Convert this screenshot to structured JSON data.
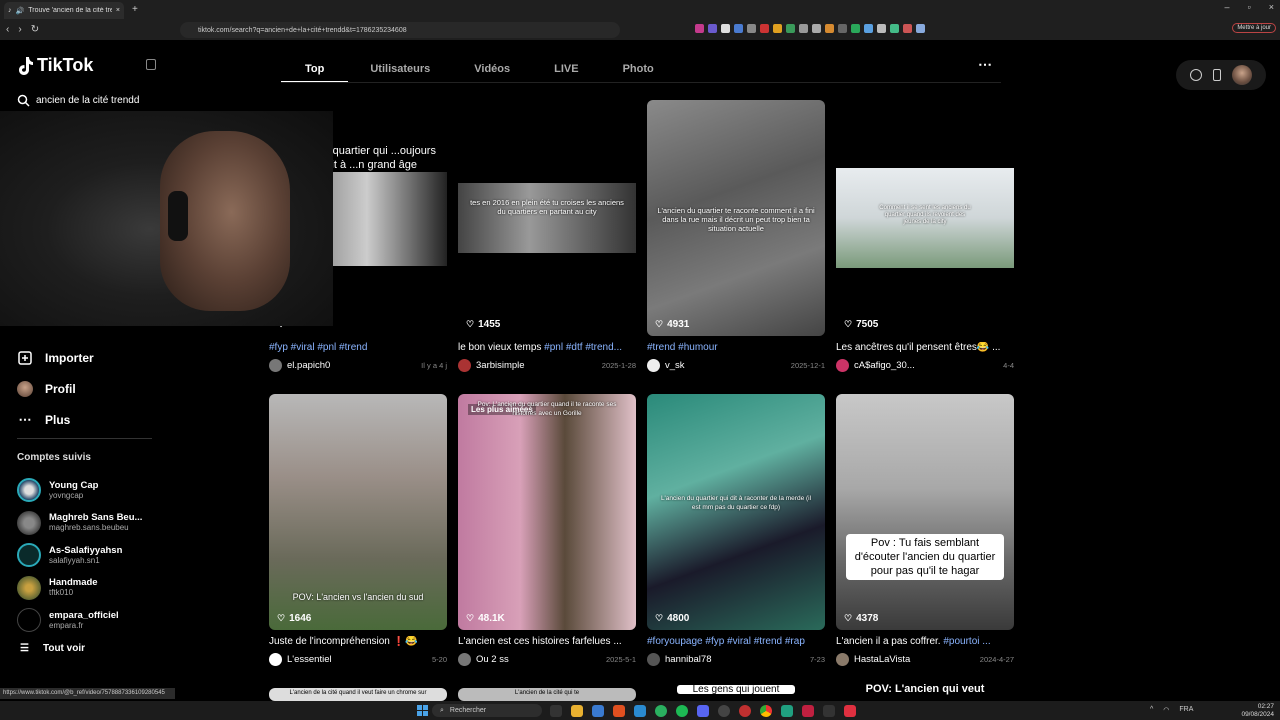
{
  "browser": {
    "tab_title": "Trouve 'ancien de la cité tren...",
    "url": "tiktok.com/search?q=ancien+de+la+cité+trendd&t=1786235234608",
    "mettre_label": "Mettre à jour",
    "status_url": "https://www.tiktok.com/@b_ref/video/7578887336109280545"
  },
  "sidebar": {
    "brand": "TikTok",
    "search_value": "ancien de la cité trendd",
    "menu": [
      {
        "label": "Importer",
        "icon": "upload-icon"
      },
      {
        "label": "Profil",
        "icon": "profile-avatar"
      },
      {
        "label": "Plus",
        "icon": "more-icon"
      }
    ],
    "following_title": "Comptes suivis",
    "following": [
      {
        "name": "Young Cap",
        "handle": "yovngcap"
      },
      {
        "name": "Maghreb Sans Beu...",
        "handle": "maghreb.sans.beubeu"
      },
      {
        "name": "As-Salafiyyahsn",
        "handle": "salafiyyah.sn1"
      },
      {
        "name": "Handmade",
        "handle": "tftk010"
      },
      {
        "name": "empara_officiel",
        "handle": "empara.fr"
      }
    ],
    "see_all": "Tout voir"
  },
  "tabs": [
    "Top",
    "Utilisateurs",
    "Vidéos",
    "LIVE",
    "Photo"
  ],
  "videos": [
    {
      "overlay": "...n du quartier qui ...oujours les petit à ...n grand âge",
      "likes": "",
      "desc_plain": "",
      "desc_tags": "#fyp #viral #pnl #trend",
      "author": "el.papich0",
      "date": "Il y a 4 j",
      "badge": ""
    },
    {
      "overlay": "tes en 2016 en plein été tu croises les anciens du quartiers en partant au city",
      "likes": "1455",
      "desc_plain": "le bon vieux temps ",
      "desc_tags": "#pnl #dtf #trend...",
      "author": "3arbisimple",
      "date": "2025-1-28",
      "badge": ""
    },
    {
      "overlay": "L'ancien du quartier te raconte comment il a fini dans la rue mais il décrit un peut trop bien ta situation actuelle",
      "likes": "4931",
      "desc_plain": "",
      "desc_tags": "#trend #humour",
      "author": "v_sk",
      "date": "2025-12-1",
      "badge": ""
    },
    {
      "overlay": "Comment il se sent les anciens du quartier quand ils revoient des jeunes de la city",
      "likes": "7505",
      "desc_plain": "Les ancêtres qu'il pensent êtres😂 ...",
      "desc_tags": "",
      "author": "cA$afigo_30...",
      "date": "4-4",
      "badge": ""
    },
    {
      "overlay": "POV: L'ancien vs l'ancien du sud",
      "likes": "1646",
      "desc_plain": "Juste de l'incompréhension ❗😂",
      "desc_tags": "",
      "author": "L'essentiel",
      "date": "5-20",
      "badge": ""
    },
    {
      "overlay": "Pov: L'ancien du quartier quand il te raconte ses histoires avec un Gorille",
      "likes": "48.1K",
      "desc_plain": "L'ancien est ces histoires farfelues ...",
      "desc_tags": "",
      "author": "Ou 2 ss",
      "date": "2025-5-1",
      "badge": "Les plus aimées"
    },
    {
      "overlay": "L'ancien du quartier qui dit à raconter de la merde (il est mm pas du quartier ce fdp)",
      "likes": "4800",
      "desc_plain": "",
      "desc_tags": "#foryoupage #fyp #viral #trend #rap",
      "author": "hannibal78",
      "date": "7-23",
      "badge": ""
    },
    {
      "overlay": "Pov : Tu fais semblant d'écouter l'ancien du quartier pour pas qu'il te hagar",
      "likes": "4378",
      "desc_plain": "L'ancien il a pas coffrer. ",
      "desc_tags": "#pourtoi ...",
      "author": "HastaLaVista",
      "date": "2024-4-27",
      "badge": ""
    }
  ],
  "bottom_row_overlays": [
    "L'ancien de la cité quand il veut faire un chrome sur",
    "L'ancien de la cité qui te",
    "Les gens qui jouent",
    "POV: L'ancien qui veut"
  ],
  "taskbar": {
    "search_label": "Rechercher",
    "lang": "FRA",
    "time": "02:27",
    "date": "09/08/2024"
  }
}
